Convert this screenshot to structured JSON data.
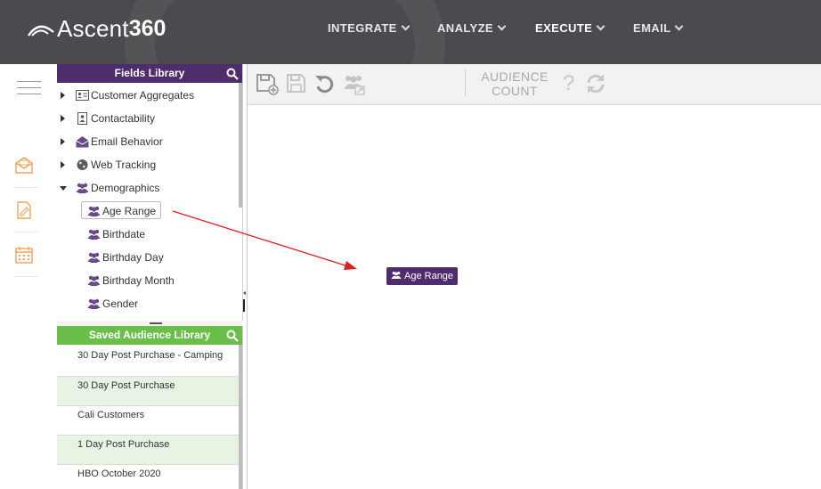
{
  "brand": {
    "name": "Ascent",
    "number": "360"
  },
  "nav": {
    "integrate": "INTEGRATE",
    "analyze": "ANALYZE",
    "execute": "EXECUTE",
    "email": "EMAIL"
  },
  "fields_library": {
    "title": "Fields Library",
    "groups": [
      {
        "label": "Customer Aggregates",
        "icon": "contact-card-icon",
        "expanded": false
      },
      {
        "label": "Contactability",
        "icon": "address-book-icon",
        "expanded": false
      },
      {
        "label": "Email Behavior",
        "icon": "open-envelope-icon",
        "expanded": false
      },
      {
        "label": "Web Tracking",
        "icon": "globe-icon",
        "expanded": false
      },
      {
        "label": "Demographics",
        "icon": "users-icon",
        "expanded": true
      }
    ],
    "demographics_children": [
      {
        "label": "Age Range",
        "selected": true
      },
      {
        "label": "Birthdate"
      },
      {
        "label": "Birthday Day"
      },
      {
        "label": "Birthday Month"
      },
      {
        "label": "Gender"
      }
    ]
  },
  "saved_library": {
    "title": "Saved Audience Library",
    "items": [
      "30 Day Post Purchase - Camping",
      "30 Day Post Purchase",
      "Cali Customers",
      "1 Day Post Purchase",
      "HBO October 2020"
    ]
  },
  "toolbar": {
    "audience_count_line1": "AUDIENCE",
    "audience_count_line2": "COUNT",
    "help": "?"
  },
  "canvas": {
    "dragged_field": "Age Range"
  },
  "colors": {
    "header_bg": "#4b4b4f",
    "fields_header": "#4f2d6d",
    "saved_header": "#6abf4b",
    "rail_icon": "#f0a35e",
    "arrow": "#e01e1e"
  }
}
